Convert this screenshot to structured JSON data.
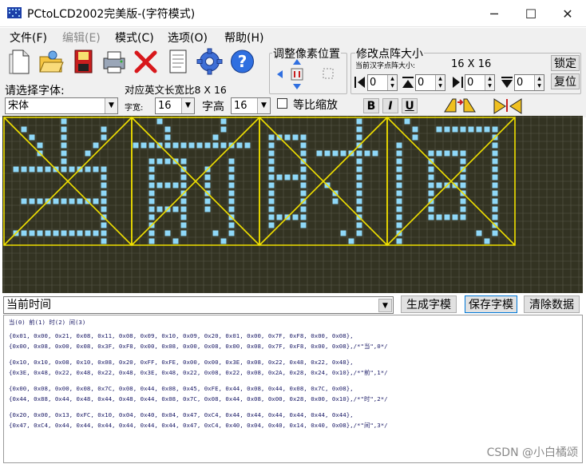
{
  "window": {
    "title": "PCtoLCD2002完美版-(字符模式)",
    "minimize": "─",
    "maximize": "☐",
    "close": "✕"
  },
  "menu": [
    {
      "label": "文件(F)",
      "enabled": true
    },
    {
      "label": "编辑(E)",
      "enabled": false
    },
    {
      "label": "模式(C)",
      "enabled": true
    },
    {
      "label": "选项(O)",
      "enabled": true
    },
    {
      "label": "帮助(H)",
      "enabled": true
    }
  ],
  "toolbar": {
    "icons": [
      "new-file-icon",
      "open-folder-icon",
      "save-icon",
      "print-icon",
      "delete-icon",
      "notepad-icon",
      "gear-icon",
      "help-icon"
    ]
  },
  "font": {
    "select_label": "请选择字体:",
    "english_width_label": "对应英文长宽比8 X 16",
    "font_value": "宋体",
    "width_label": "字宽:",
    "width_value": "16",
    "height_label": "字高",
    "height_value": "16",
    "proportional_label": "等比缩放",
    "proportional_checked": false,
    "bold_label": "B",
    "italic_label": "I",
    "underline_label": "U"
  },
  "pixel_adjust": {
    "title": "调整像素位置"
  },
  "matrix": {
    "title": "修改点阵大小",
    "current_label": "当前汉字点阵大小:",
    "current_value": "16 X 16",
    "lock_label": "锁定",
    "reset_label": "复位",
    "spins": [
      "0",
      "0",
      "0",
      "0"
    ]
  },
  "canvas": {
    "characters": [
      "当",
      "前",
      "时",
      "间"
    ],
    "pixel_on": "#8fd8f8",
    "grid_bg": "#333322",
    "frame": "#f0e000"
  },
  "bottom": {
    "input_value": "当前时间",
    "generate_label": "生成字模",
    "save_label": "保存字模",
    "clear_label": "清除数据"
  },
  "output": {
    "header": "当(0) 前(1) 时(2) 间(3)",
    "lines": [
      "{0x01, 0x00, 0x21, 0x08, 0x11, 0x08, 0x09, 0x10, 0x09, 0x20, 0x01, 0x00, 0x7F, 0xF8, 0x00, 0x08},",
      "{0x00, 0x08, 0x00, 0x08, 0x3F, 0xF8, 0x00, 0x08, 0x00, 0x08, 0x00, 0x08, 0x7F, 0xF8, 0x00, 0x08},/*\"当\",0*/",
      "",
      "{0x10, 0x10, 0x08, 0x10, 0x08, 0x20, 0xFF, 0xFE, 0x00, 0x00, 0x3E, 0x08, 0x22, 0x48, 0x22, 0x48},",
      "{0x3E, 0x48, 0x22, 0x48, 0x22, 0x48, 0x3E, 0x48, 0x22, 0x08, 0x22, 0x08, 0x2A, 0x28, 0x24, 0x10},/*\"前\",1*/",
      "",
      "{0x00, 0x08, 0x00, 0x08, 0x7C, 0x08, 0x44, 0x08, 0x45, 0xFE, 0x44, 0x08, 0x44, 0x08, 0x7C, 0x08},",
      "{0x44, 0x88, 0x44, 0x48, 0x44, 0x48, 0x44, 0x08, 0x7C, 0x08, 0x44, 0x08, 0x00, 0x28, 0x00, 0x10},/*\"时\",2*/",
      "",
      "{0x20, 0x00, 0x13, 0xFC, 0x10, 0x04, 0x40, 0x04, 0x47, 0xC4, 0x44, 0x44, 0x44, 0x44, 0x44, 0x44},",
      "{0x47, 0xC4, 0x44, 0x44, 0x44, 0x44, 0x44, 0x44, 0x47, 0xC4, 0x40, 0x04, 0x40, 0x14, 0x40, 0x08},/*\"间\",3*/"
    ]
  },
  "watermark": "CSDN @小白橘颂"
}
